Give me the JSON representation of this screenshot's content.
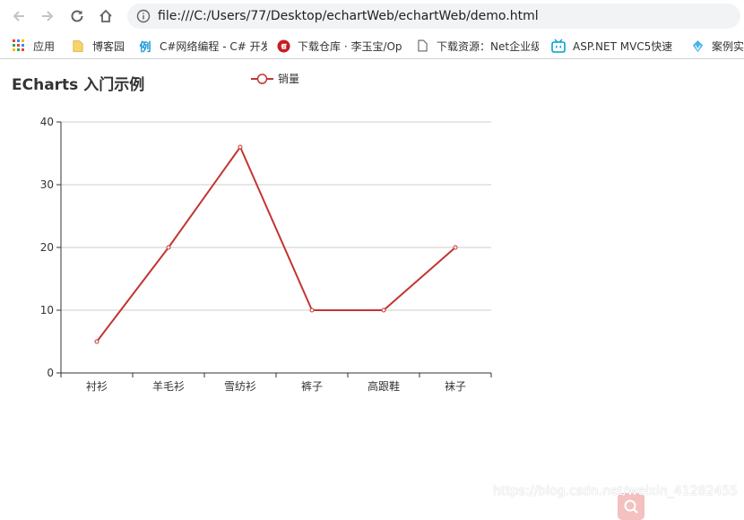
{
  "browser": {
    "url": "file:///C:/Users/77/Desktop/echartWeb/echartWeb/demo.html",
    "bookmarks": [
      {
        "label": "应用",
        "icon": "apps-grid-icon"
      },
      {
        "label": "博客园",
        "icon": "folder-icon"
      },
      {
        "label": "C#网络编程 - C# 开发",
        "icon": "example-logo-icon"
      },
      {
        "label": "下载仓库 · 李玉宝/Op",
        "icon": "gitee-logo-icon"
      },
      {
        "label": "下载资源：Net企业级",
        "icon": "page-icon"
      },
      {
        "label": "ASP.NET MVC5快速",
        "icon": "bilibili-logo-icon"
      },
      {
        "label": "案例实",
        "icon": "diamond-logo-icon"
      }
    ]
  },
  "page": {
    "title": "ECharts 入门示例",
    "watermark": "https://blog.csdn.net/weixin_41282455"
  },
  "colors": {
    "series": "#c23531",
    "grid": "#cccccc",
    "axis": "#333333",
    "float_button": "#f4c0c0"
  },
  "chart_data": {
    "type": "line",
    "title": "ECharts 入门示例",
    "categories": [
      "衬衫",
      "羊毛衫",
      "雪纺衫",
      "裤子",
      "高跟鞋",
      "袜子"
    ],
    "series": [
      {
        "name": "销量",
        "values": [
          5,
          20,
          36,
          10,
          10,
          20
        ]
      }
    ],
    "ylim": [
      0,
      40
    ],
    "yticks": [
      0,
      10,
      20,
      30,
      40
    ],
    "grid": true,
    "legend": "top-center"
  }
}
